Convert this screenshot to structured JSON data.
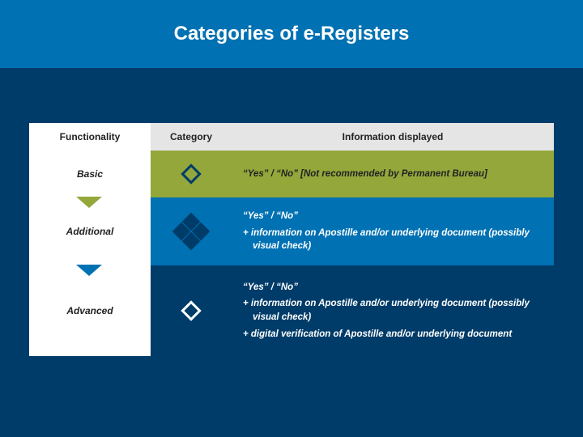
{
  "title": "Categories of e-Registers",
  "headers": {
    "functionality": "Functionality",
    "category": "Category",
    "information": "Information displayed"
  },
  "rows": {
    "basic": {
      "label": "Basic",
      "info1": "“Yes” / “No” [Not recommended by Permanent Bureau]"
    },
    "additional": {
      "label": "Additional",
      "info1": "“Yes” / “No”",
      "info2": "+ information on Apostille and/or underlying document (possibly visual check)"
    },
    "advanced": {
      "label": "Advanced",
      "info1": "“Yes” / “No”",
      "info2": "+ information on Apostille and/or underlying document (possibly visual check)",
      "info3": "+ digital verification of Apostille and/or underlying document"
    }
  }
}
